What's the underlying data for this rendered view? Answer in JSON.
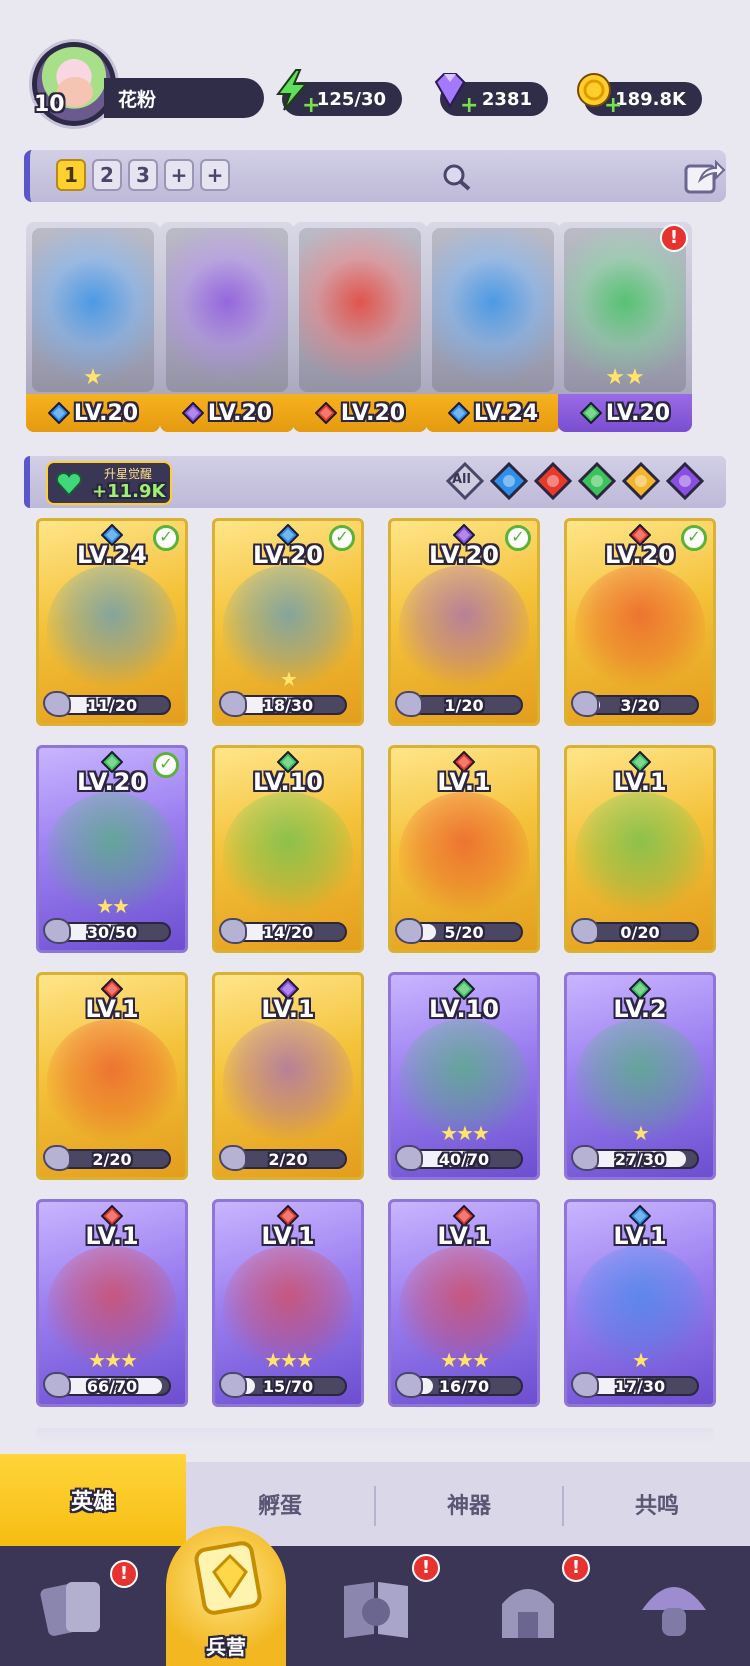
{
  "player": {
    "level": "10",
    "name": "花粉"
  },
  "resources": {
    "energy": "125/30",
    "gems": "2381",
    "gold": "189.8K"
  },
  "team_tabs": [
    "1",
    "2",
    "3",
    "+",
    "+"
  ],
  "team_slots": [
    {
      "level": "LV.20",
      "element": "water",
      "stars": "★",
      "bar": "gold"
    },
    {
      "level": "LV.20",
      "element": "dark",
      "stars": "",
      "bar": "gold"
    },
    {
      "level": "LV.20",
      "element": "fire",
      "stars": "",
      "bar": "gold"
    },
    {
      "level": "LV.24",
      "element": "water",
      "stars": "",
      "bar": "gold"
    },
    {
      "level": "LV.20",
      "element": "wind",
      "stars": "★★",
      "bar": "purple"
    }
  ],
  "awaken": {
    "label": "升星觉醒",
    "value": "+11.9K"
  },
  "filters": {
    "all_label": "All"
  },
  "heroes": [
    {
      "level": "LV.24",
      "element": "water",
      "progress": "11/20",
      "fill": 0.55,
      "rarity": "gold",
      "check": true,
      "stars": ""
    },
    {
      "level": "LV.20",
      "element": "water",
      "progress": "18/30",
      "fill": 0.6,
      "rarity": "gold",
      "check": true,
      "stars": "★"
    },
    {
      "level": "LV.20",
      "element": "dark",
      "progress": "1/20",
      "fill": 0.05,
      "rarity": "gold",
      "check": true,
      "stars": ""
    },
    {
      "level": "LV.20",
      "element": "fire",
      "progress": "3/20",
      "fill": 0.15,
      "rarity": "gold",
      "check": true,
      "stars": ""
    },
    {
      "level": "LV.20",
      "element": "wind",
      "progress": "30/50",
      "fill": 0.6,
      "rarity": "purple",
      "check": true,
      "stars": "★★"
    },
    {
      "level": "LV.10",
      "element": "wind",
      "progress": "14/20",
      "fill": 0.7,
      "rarity": "gold",
      "check": false,
      "stars": ""
    },
    {
      "level": "LV.1",
      "element": "fire",
      "progress": "5/20",
      "fill": 0.25,
      "rarity": "gold",
      "check": false,
      "stars": ""
    },
    {
      "level": "LV.1",
      "element": "wind",
      "progress": "0/20",
      "fill": 0.0,
      "rarity": "gold",
      "check": false,
      "stars": ""
    },
    {
      "level": "LV.1",
      "element": "fire",
      "progress": "2/20",
      "fill": 0.1,
      "rarity": "gold",
      "check": false,
      "stars": ""
    },
    {
      "level": "LV.1",
      "element": "dark",
      "progress": "2/20",
      "fill": 0.1,
      "rarity": "gold",
      "check": false,
      "stars": ""
    },
    {
      "level": "LV.10",
      "element": "wind",
      "progress": "40/70",
      "fill": 0.57,
      "rarity": "purple",
      "check": false,
      "stars": "★★★"
    },
    {
      "level": "LV.2",
      "element": "wind",
      "progress": "27/30",
      "fill": 0.9,
      "rarity": "purple",
      "check": false,
      "stars": "★"
    },
    {
      "level": "LV.1",
      "element": "fire",
      "progress": "66/70",
      "fill": 0.94,
      "rarity": "purple",
      "check": false,
      "stars": "★★★"
    },
    {
      "level": "LV.1",
      "element": "fire",
      "progress": "15/70",
      "fill": 0.21,
      "rarity": "purple",
      "check": false,
      "stars": "★★★"
    },
    {
      "level": "LV.1",
      "element": "fire",
      "progress": "16/70",
      "fill": 0.23,
      "rarity": "purple",
      "check": false,
      "stars": "★★★"
    },
    {
      "level": "LV.1",
      "element": "water",
      "progress": "17/30",
      "fill": 0.57,
      "rarity": "purple",
      "check": false,
      "stars": "★"
    }
  ],
  "subtabs": [
    "英雄",
    "孵蛋",
    "神器",
    "共鸣"
  ],
  "nav": {
    "barracks_label": "兵营"
  },
  "colors": {
    "water": "#2f8fe8",
    "fire": "#e8392a",
    "wind": "#3cc25a",
    "dark": "#8a4fe0",
    "light": "#f2b62a"
  }
}
